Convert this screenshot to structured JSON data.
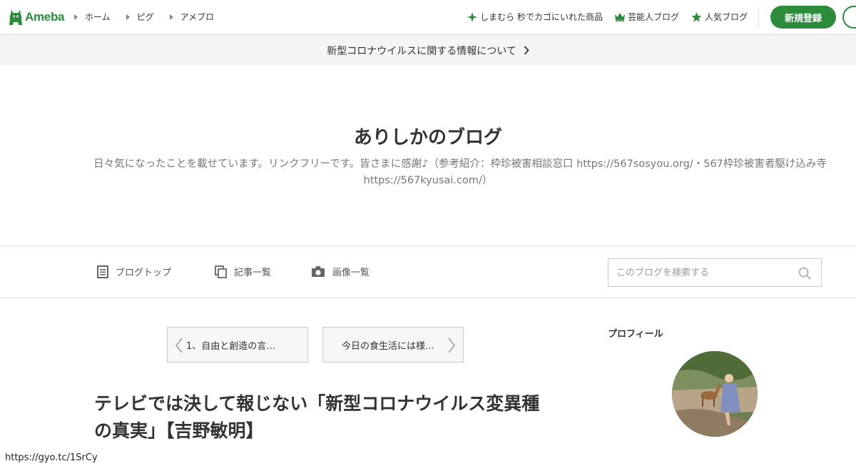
{
  "header": {
    "logo_text": "Ameba",
    "nav": [
      {
        "label": "ホーム"
      },
      {
        "label": "ピグ"
      },
      {
        "label": "アメブロ"
      }
    ],
    "right_nav": [
      {
        "label": "しまむら 秒でカゴにいれた商品",
        "icon": "sparkle-icon"
      },
      {
        "label": "芸能人ブログ",
        "icon": "crown-icon"
      },
      {
        "label": "人気ブログ",
        "icon": "star-icon"
      }
    ],
    "signup_label": "新規登録",
    "brand_color": "#2d8c3c"
  },
  "notice": {
    "text": "新型コロナウイルスに関する情報について"
  },
  "blog": {
    "title": "ありしかのブログ",
    "description_line1": "日々気になったことを載せています。リンクフリーです。皆さまに感謝♪（参考紹介：枠珍被害相談窓口 https://567sosyou.org/・567枠珍被害者駆け込み寺",
    "description_line2": "https://567kyusai.com/）"
  },
  "blog_nav": {
    "items": [
      {
        "label": "ブログトップ",
        "icon": "document-icon"
      },
      {
        "label": "記事一覧",
        "icon": "copy-icon"
      },
      {
        "label": "画像一覧",
        "icon": "camera-icon"
      }
    ],
    "search_placeholder": "このブログを検索する"
  },
  "pager": {
    "prev_label": "1、自由と創造の言…",
    "next_label": "今日の食生活には様…"
  },
  "article": {
    "title": "テレビでは決して報じない「新型コロナウイルス変異種の真実」【吉野敏明】"
  },
  "sidebar": {
    "profile_heading": "プロフィール"
  },
  "status_bar": {
    "url": "https://gyo.tc/1SrCy"
  }
}
